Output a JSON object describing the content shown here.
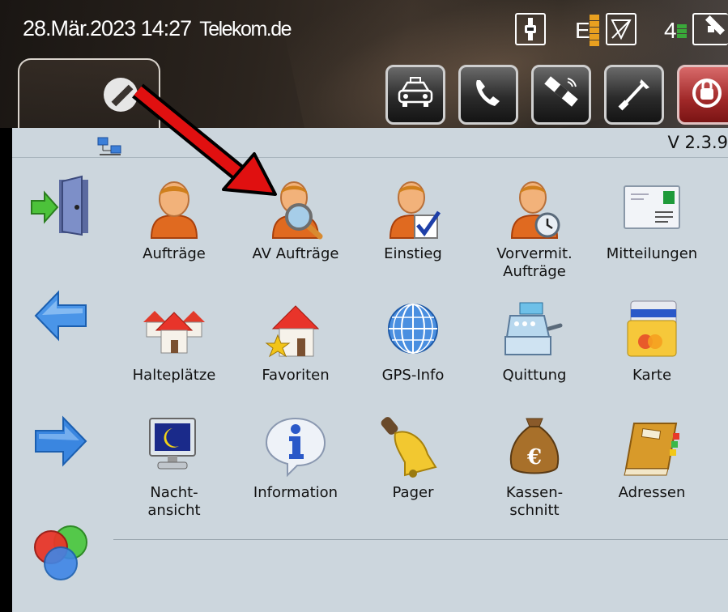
{
  "status": {
    "datetime": "28.Mär.2023 14:27",
    "carrier": "Telekom.de",
    "network_letter": "E",
    "sat_count": "4"
  },
  "version": "V 2.3.9",
  "toolbar": {
    "buttons": [
      {
        "icon": "taxi-icon"
      },
      {
        "icon": "phone-icon"
      },
      {
        "icon": "satellite-icon"
      },
      {
        "icon": "tools-icon"
      },
      {
        "icon": "alarm-icon",
        "color": "#b02a2a"
      }
    ]
  },
  "menu": {
    "rows": [
      [
        {
          "label": "Aufträge",
          "icon": "person-icon"
        },
        {
          "label": "AV Aufträge",
          "icon": "person-search-icon"
        },
        {
          "label": "Einstieg",
          "icon": "person-check-icon"
        },
        {
          "label": "Vorvermit.\nAufträge",
          "icon": "person-clock-icon"
        },
        {
          "label": "Mitteilungen",
          "icon": "message-icon"
        }
      ],
      [
        {
          "label": "Halteplätze",
          "icon": "houses-icon"
        },
        {
          "label": "Favoriten",
          "icon": "house-star-icon"
        },
        {
          "label": "GPS-Info",
          "icon": "globe-icon"
        },
        {
          "label": "Quittung",
          "icon": "cash-register-icon"
        },
        {
          "label": "Karte",
          "icon": "credit-card-icon"
        }
      ],
      [
        {
          "label": "Nacht-\nansicht",
          "icon": "night-monitor-icon"
        },
        {
          "label": "Information",
          "icon": "info-bubble-icon"
        },
        {
          "label": "Pager",
          "icon": "bell-icon"
        },
        {
          "label": "Kassen-\nschnitt",
          "icon": "money-bag-icon"
        },
        {
          "label": "Adressen",
          "icon": "address-book-icon"
        }
      ]
    ]
  },
  "colors": {
    "panel_bg": "#ccd6dd",
    "annotation_arrow": "#e01010",
    "accent_orange": "#e06a20",
    "nav_blue": "#2f7fd6"
  }
}
